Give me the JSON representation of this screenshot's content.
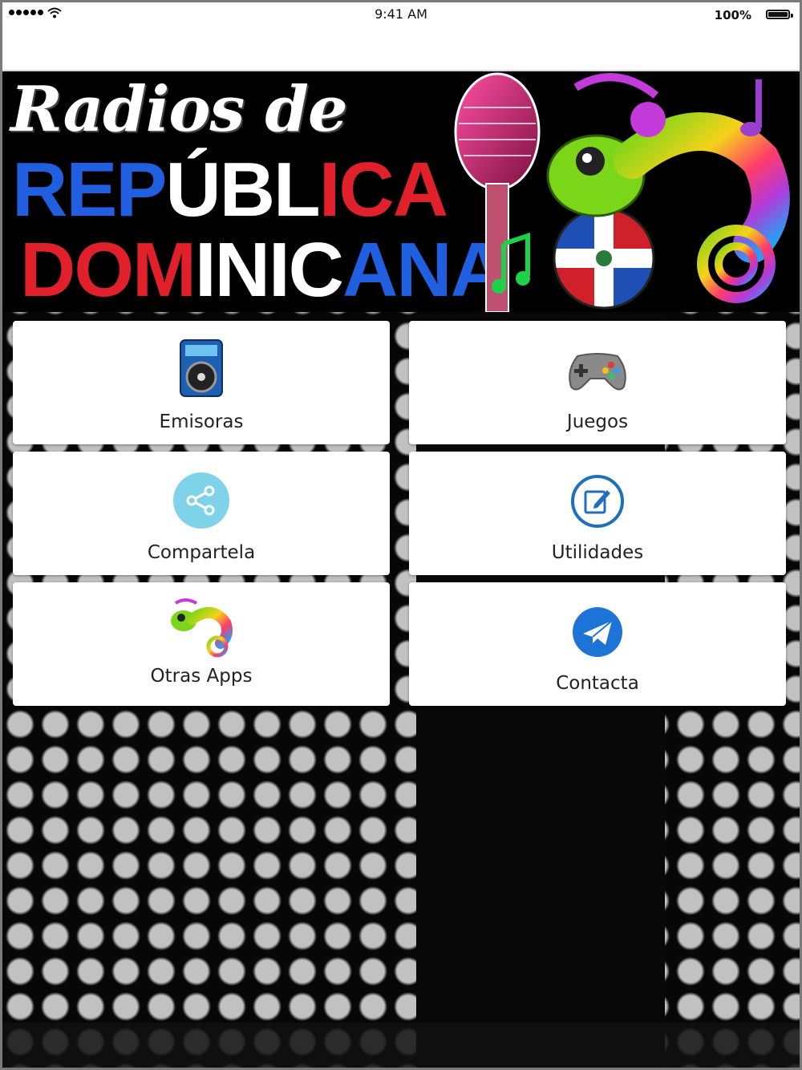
{
  "status_bar": {
    "time": "9:41 AM",
    "battery": "100%"
  },
  "banner": {
    "line1": "Radios de",
    "line2_parts": [
      "REP",
      "ÚBL",
      "ICA"
    ],
    "line3_parts": [
      "DOM",
      "INIC",
      "ANA"
    ]
  },
  "menu": {
    "emisoras": "Emisoras",
    "juegos": "Juegos",
    "compartela": "Compartela",
    "utilidades": "Utilidades",
    "otras_apps": "Otras Apps",
    "contacta": "Contacta"
  },
  "icons": {
    "emisoras": "radio-player-icon",
    "juegos": "gamepad-icon",
    "compartela": "share-icon",
    "utilidades": "edit-icon",
    "otras_apps": "chameleon-icon",
    "contacta": "mail-icon"
  },
  "colors": {
    "blue": "#1f5fe0",
    "red": "#e0202a",
    "share_bg": "#7fd3e8",
    "utilities_ring": "#1f6fbf",
    "mail_bg": "#1e73d6"
  }
}
